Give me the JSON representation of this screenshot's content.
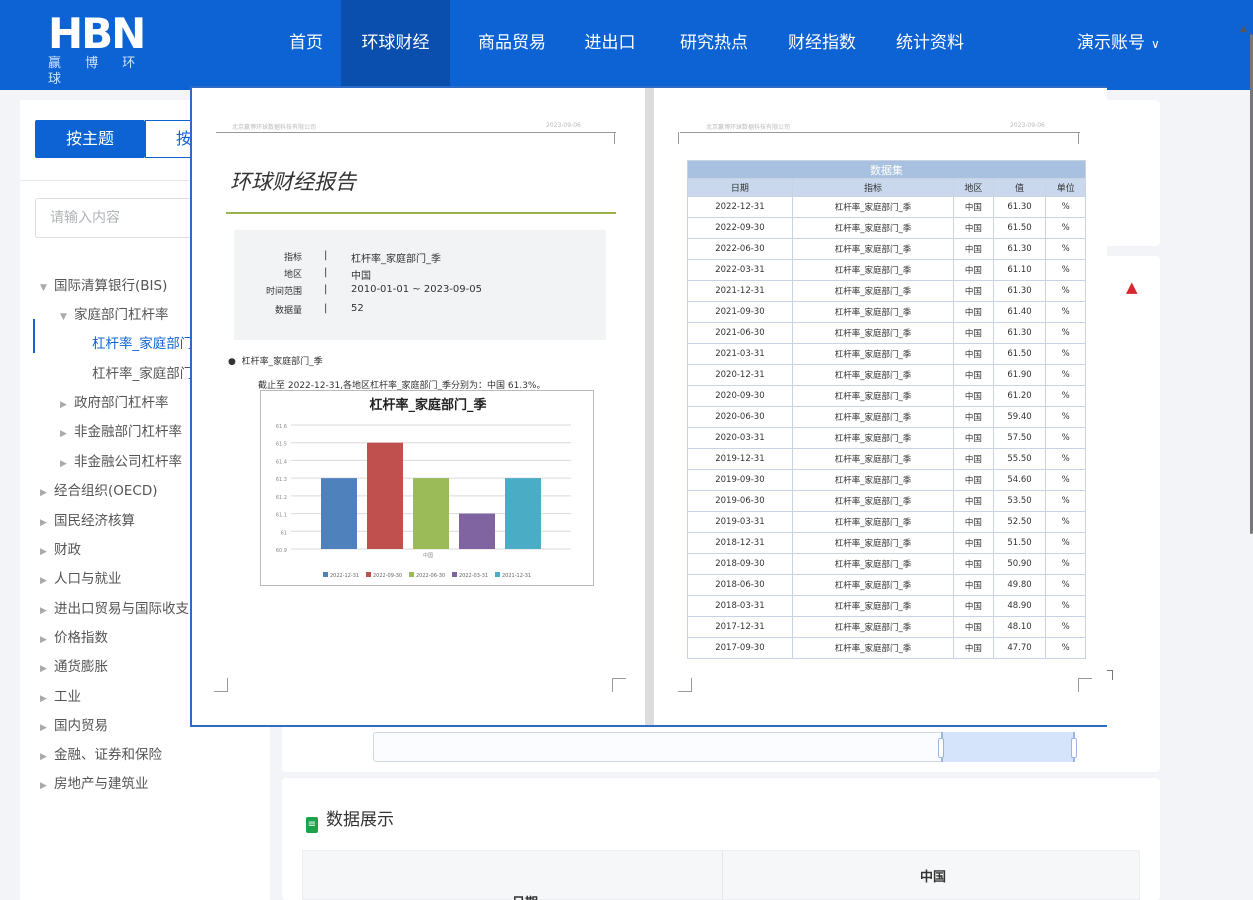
{
  "header": {
    "logo_text": "HBN",
    "logo_sub": "赢 博 环 球",
    "nav": [
      "首页",
      "环球财经",
      "商品贸易",
      "进出口",
      "研究热点",
      "财经指数",
      "统计资料"
    ],
    "active_nav": "环球财经",
    "account": "演示账号"
  },
  "sidebar": {
    "tab_theme": "按主题",
    "tab_other": "按",
    "search_placeholder": "请输入内容",
    "tree": [
      {
        "label": "国际清算银行(BIS)",
        "level": 0,
        "expanded": true
      },
      {
        "label": "家庭部门杠杆率",
        "level": 1,
        "expanded": true
      },
      {
        "label": "杠杆率_家庭部门_季",
        "level": 2,
        "active": true
      },
      {
        "label": "杠杆率_家庭部门_年",
        "level": 2
      },
      {
        "label": "政府部门杠杆率",
        "level": 1
      },
      {
        "label": "非金融部门杠杆率",
        "level": 1
      },
      {
        "label": "非金融公司杠杆率",
        "level": 1
      },
      {
        "label": "经合组织(OECD)",
        "level": 0
      },
      {
        "label": "国民经济核算",
        "level": 0
      },
      {
        "label": "财政",
        "level": 0
      },
      {
        "label": "人口与就业",
        "level": 0
      },
      {
        "label": "进出口贸易与国际收支",
        "level": 0
      },
      {
        "label": "价格指数",
        "level": 0
      },
      {
        "label": "通货膨胀",
        "level": 0
      },
      {
        "label": "工业",
        "level": 0
      },
      {
        "label": "国内贸易",
        "level": 0
      },
      {
        "label": "金融、证券和保险",
        "level": 0
      },
      {
        "label": "房地产与建筑业",
        "level": 0
      }
    ]
  },
  "main": {
    "display_title": "数据展示",
    "table_col_date": "日期",
    "table_col_region": "中国"
  },
  "preview": {
    "left_page": {
      "header_company": "北京赢博环球数据科技有限公司",
      "header_date": "2023-09-06",
      "title": "环球财经报告",
      "info": [
        {
          "key": "指标",
          "value": "杠杆率_家庭部门_季"
        },
        {
          "key": "地区",
          "value": "中国"
        },
        {
          "key": "时间范围",
          "value": "2010-01-01 ~ 2023-09-05"
        },
        {
          "key": "数据量",
          "value": "52"
        }
      ],
      "bullet": "杠杆率_家庭部门_季",
      "summary": "截止至 2022-12-31,各地区杠杆率_家庭部门_季分别为：中国 61.3%。"
    },
    "right_page": {
      "header_company": "北京赢博环球数据科技有限公司",
      "header_date": "2023-09-06",
      "caption": "数据集",
      "columns": [
        "日期",
        "指标",
        "地区",
        "值",
        "单位"
      ],
      "rows": [
        [
          "2022-12-31",
          "杠杆率_家庭部门_季",
          "中国",
          "61.30",
          "%"
        ],
        [
          "2022-09-30",
          "杠杆率_家庭部门_季",
          "中国",
          "61.50",
          "%"
        ],
        [
          "2022-06-30",
          "杠杆率_家庭部门_季",
          "中国",
          "61.30",
          "%"
        ],
        [
          "2022-03-31",
          "杠杆率_家庭部门_季",
          "中国",
          "61.10",
          "%"
        ],
        [
          "2021-12-31",
          "杠杆率_家庭部门_季",
          "中国",
          "61.30",
          "%"
        ],
        [
          "2021-09-30",
          "杠杆率_家庭部门_季",
          "中国",
          "61.40",
          "%"
        ],
        [
          "2021-06-30",
          "杠杆率_家庭部门_季",
          "中国",
          "61.30",
          "%"
        ],
        [
          "2021-03-31",
          "杠杆率_家庭部门_季",
          "中国",
          "61.50",
          "%"
        ],
        [
          "2020-12-31",
          "杠杆率_家庭部门_季",
          "中国",
          "61.90",
          "%"
        ],
        [
          "2020-09-30",
          "杠杆率_家庭部门_季",
          "中国",
          "61.20",
          "%"
        ],
        [
          "2020-06-30",
          "杠杆率_家庭部门_季",
          "中国",
          "59.40",
          "%"
        ],
        [
          "2020-03-31",
          "杠杆率_家庭部门_季",
          "中国",
          "57.50",
          "%"
        ],
        [
          "2019-12-31",
          "杠杆率_家庭部门_季",
          "中国",
          "55.50",
          "%"
        ],
        [
          "2019-09-30",
          "杠杆率_家庭部门_季",
          "中国",
          "54.60",
          "%"
        ],
        [
          "2019-06-30",
          "杠杆率_家庭部门_季",
          "中国",
          "53.50",
          "%"
        ],
        [
          "2019-03-31",
          "杠杆率_家庭部门_季",
          "中国",
          "52.50",
          "%"
        ],
        [
          "2018-12-31",
          "杠杆率_家庭部门_季",
          "中国",
          "51.50",
          "%"
        ],
        [
          "2018-09-30",
          "杠杆率_家庭部门_季",
          "中国",
          "50.90",
          "%"
        ],
        [
          "2018-06-30",
          "杠杆率_家庭部门_季",
          "中国",
          "49.80",
          "%"
        ],
        [
          "2018-03-31",
          "杠杆率_家庭部门_季",
          "中国",
          "48.90",
          "%"
        ],
        [
          "2017-12-31",
          "杠杆率_家庭部门_季",
          "中国",
          "48.10",
          "%"
        ],
        [
          "2017-09-30",
          "杠杆率_家庭部门_季",
          "中国",
          "47.70",
          "%"
        ]
      ]
    }
  },
  "chart_data": {
    "type": "bar",
    "title": "杠杆率_家庭部门_季",
    "categories": [
      "中国"
    ],
    "series": [
      {
        "name": "2022-12-31",
        "values": [
          61.3
        ],
        "color": "#4f81bd"
      },
      {
        "name": "2022-09-30",
        "values": [
          61.5
        ],
        "color": "#c0504d"
      },
      {
        "name": "2022-06-30",
        "values": [
          61.3
        ],
        "color": "#9bbb59"
      },
      {
        "name": "2022-03-31",
        "values": [
          61.1
        ],
        "color": "#8064a2"
      },
      {
        "name": "2021-12-31",
        "values": [
          61.3
        ],
        "color": "#4bacc6"
      }
    ],
    "yticks": [
      "61.6",
      "61.5",
      "61.4",
      "61.3",
      "61.2",
      "61.1",
      "61",
      "60.9"
    ],
    "ylim": [
      60.9,
      61.6
    ],
    "grid": true,
    "legend": "bottom"
  },
  "colors": {
    "brand": "#0d63d4",
    "nav_active": "#0a4fae",
    "alert": "#d6262f"
  }
}
